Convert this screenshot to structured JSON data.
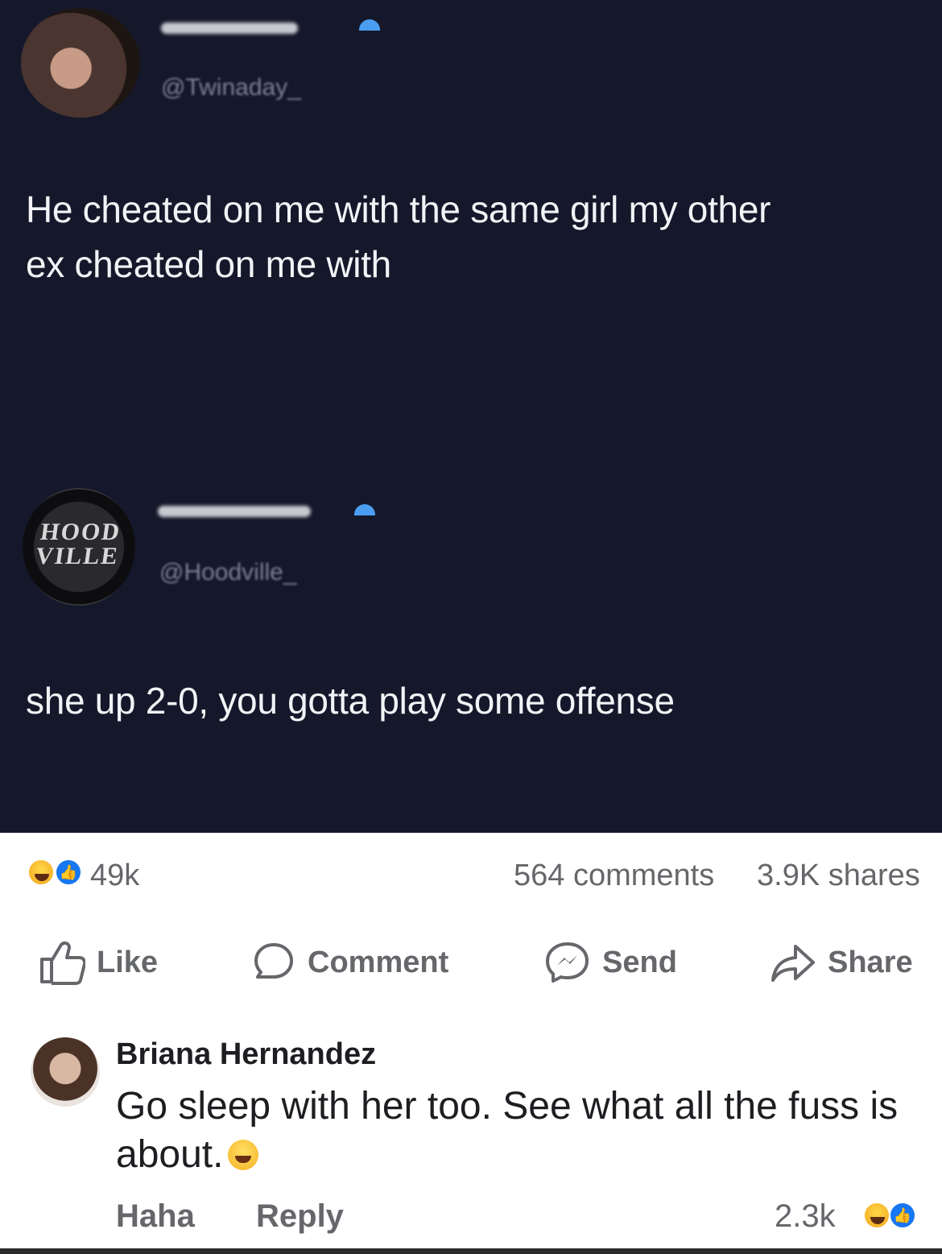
{
  "tweet": {
    "author1_handle": "@Twinaday_",
    "post1_text_line1": "He cheated on me with the same girl my other",
    "post1_text_line2": "ex cheated on me with",
    "author2_logo": "HOOD VILLE",
    "author2_handle": "@Hoodville_",
    "post2_text": "she up 2-0, you gotta play some offense"
  },
  "post_stats": {
    "reactions_count": "49k",
    "comments": "564 comments",
    "shares": "3.9K shares"
  },
  "actions": {
    "like": "Like",
    "comment": "Comment",
    "send": "Send",
    "share": "Share"
  },
  "comment": {
    "author": "Briana Hernandez",
    "text": "Go sleep with her too. See what all the fuss is about.",
    "haha_label": "Haha",
    "reply_label": "Reply",
    "reaction_count": "2.3k"
  },
  "icons": {
    "reaction_haha": "haha-emoji-icon",
    "reaction_like": "like-reaction-icon",
    "like": "thumbs-up-icon",
    "comment": "speech-bubble-icon",
    "send": "messenger-icon",
    "share": "share-arrow-icon"
  },
  "colors": {
    "dark_bg": "#15182a",
    "fb_gray": "#65676b",
    "fb_blue": "#1877f2",
    "verified_blue": "#4a9df0"
  }
}
